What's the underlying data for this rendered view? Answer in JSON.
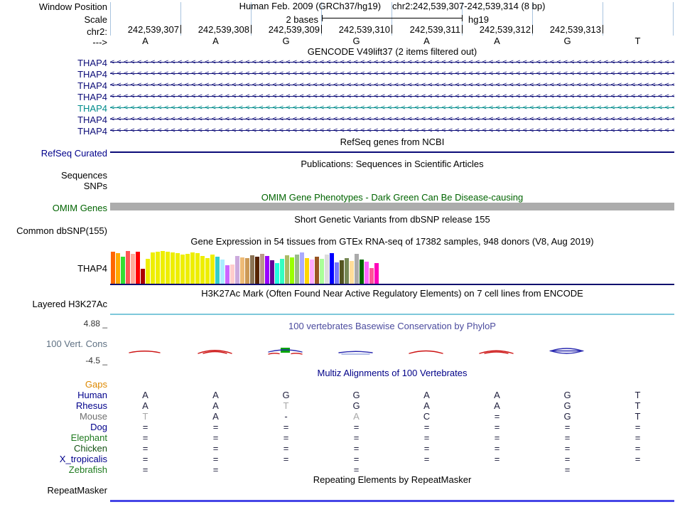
{
  "header": {
    "window_label": "Window Position",
    "assembly_title": "Human Feb. 2009 (GRCh37/hg19)",
    "position_range": "chr2:242,539,307-242,539,314 (8 bp)",
    "scale_label": "Scale",
    "scale_value": "2 bases",
    "scale_genome": "hg19",
    "chrom_label": "chr2:",
    "strand_label": "--->",
    "positions": [
      "242,539,307",
      "242,539,308",
      "242,539,309",
      "242,539,310",
      "242,539,311",
      "242,539,312",
      "242,539,313"
    ],
    "bases": [
      "A",
      "A",
      "G",
      "G",
      "A",
      "A",
      "G",
      "T"
    ]
  },
  "tracks": {
    "gencode": {
      "title": "GENCODE V49lift37 (2 items filtered out)",
      "arrow": "<",
      "rows": [
        {
          "label": "THAP4",
          "color": "#0C0C78"
        },
        {
          "label": "THAP4",
          "color": "#0C0C78"
        },
        {
          "label": "THAP4",
          "color": "#0C0C78"
        },
        {
          "label": "THAP4",
          "color": "#0C0C78"
        },
        {
          "label": "THAP4",
          "color": "#008B8B"
        },
        {
          "label": "THAP4",
          "color": "#0C0C78"
        },
        {
          "label": "THAP4",
          "color": "#0C0C78"
        }
      ]
    },
    "refseq": {
      "title": "RefSeq genes from NCBI",
      "label": "RefSeq Curated",
      "color": "#0C0C78"
    },
    "publications": {
      "title": "Publications: Sequences in Scientific Articles",
      "rows": [
        "Sequences",
        "SNPs"
      ]
    },
    "omim": {
      "title": "OMIM Gene Phenotypes - Dark Green Can Be Disease-causing",
      "label": "OMIM Genes",
      "color": "#006400",
      "bar_color": "#ACACAC"
    },
    "dbsnp": {
      "title": "Short Genetic Variants from dbSNP release 155",
      "label": "Common dbSNP(155)"
    },
    "gtex": {
      "title": "Gene Expression in 54 tissues from GTEx RNA-seq of 17382 samples, 948 donors (V8, Aug 2019)",
      "label": "THAP4"
    },
    "h3k27ac": {
      "title": "H3K27Ac Mark (Often Found Near Active Regulatory Elements) on 7 cell lines from ENCODE",
      "label": "Layered H3K27Ac",
      "color": "#7EC8DB"
    },
    "phylop": {
      "title": "100 vertebrates Basewise Conservation by PhyloP",
      "label": "100 Vert. Cons",
      "max": "4.88 _",
      "min": "-4.5 _",
      "title_color": "#4B4B9E",
      "label_color": "#5F7183"
    },
    "multiz": {
      "title": "Multiz Alignments of 100 Vertebrates",
      "title_color": "#000088",
      "rows": [
        {
          "label": "Gaps",
          "color": "#DD8800",
          "cells": [
            {},
            {},
            {},
            {},
            {},
            {},
            {},
            {}
          ]
        },
        {
          "label": "Human",
          "color": "#00008B",
          "cells": [
            {
              "t": "A"
            },
            {
              "t": "A"
            },
            {
              "t": "G"
            },
            {
              "t": "G"
            },
            {
              "t": "A"
            },
            {
              "t": "A"
            },
            {
              "t": "G"
            },
            {
              "t": "T"
            }
          ]
        },
        {
          "label": "Rhesus",
          "color": "#00008B",
          "cells": [
            {
              "t": "A"
            },
            {
              "t": "A"
            },
            {
              "t": "T",
              "gray": true
            },
            {
              "t": "G"
            },
            {
              "t": "A"
            },
            {
              "t": "A"
            },
            {
              "t": "G"
            },
            {
              "t": "T"
            }
          ]
        },
        {
          "label": "Mouse",
          "color": "#6E6E6E",
          "cells": [
            {
              "t": "T",
              "gray": true
            },
            {
              "t": "A"
            },
            {
              "t": "-"
            },
            {
              "t": "A",
              "gray": true
            },
            {
              "t": "C"
            },
            {
              "t": "="
            },
            {
              "t": "G"
            },
            {
              "t": "T"
            }
          ]
        },
        {
          "label": "Dog",
          "color": "#00008B",
          "cells": [
            {
              "t": "="
            },
            {
              "t": "="
            },
            {
              "t": "="
            },
            {
              "t": "="
            },
            {
              "t": "="
            },
            {
              "t": "="
            },
            {
              "t": "="
            },
            {
              "t": "="
            }
          ]
        },
        {
          "label": "Elephant",
          "color": "#1F7A1F",
          "cells": [
            {
              "t": "="
            },
            {
              "t": "="
            },
            {
              "t": "="
            },
            {
              "t": "="
            },
            {
              "t": "="
            },
            {
              "t": "="
            },
            {
              "t": "="
            },
            {
              "t": "="
            }
          ]
        },
        {
          "label": "Chicken",
          "color": "#145214",
          "cells": [
            {
              "t": "="
            },
            {
              "t": "="
            },
            {
              "t": "="
            },
            {
              "t": "="
            },
            {
              "t": "="
            },
            {
              "t": "="
            },
            {
              "t": "="
            },
            {
              "t": "="
            }
          ]
        },
        {
          "label": "X_tropicalis",
          "color": "#00008B",
          "cells": [
            {
              "t": "="
            },
            {
              "t": "="
            },
            {
              "t": "="
            },
            {
              "t": "="
            },
            {
              "t": "="
            },
            {
              "t": "="
            },
            {
              "t": "="
            },
            {
              "t": "="
            }
          ]
        },
        {
          "label": "Zebrafish",
          "color": "#1F7A1F",
          "cells": [
            {
              "t": "="
            },
            {
              "t": "="
            },
            {},
            {
              "t": "="
            },
            {},
            {},
            {
              "t": "="
            },
            {}
          ]
        }
      ]
    },
    "repeatmasker": {
      "title": "Repeating Elements by RepeatMasker",
      "label": "RepeatMasker"
    }
  },
  "chart_data": {
    "type": "bar",
    "title": "Gene Expression in 54 tissues from GTEx RNA-seq of 17382 samples, 948 donors (V8, Aug 2019)",
    "gene": "THAP4",
    "note": "54 GTEx tissue bars; tissue names not visible in image; values are bar heights (px) estimated from screenshot",
    "values": [
      45,
      43,
      38,
      46,
      42,
      45,
      21,
      35,
      44,
      45,
      46,
      45,
      44,
      43,
      41,
      42,
      44,
      43,
      39,
      36,
      41,
      38,
      34,
      26,
      27,
      39,
      37,
      36,
      40,
      38,
      42,
      39,
      33,
      29,
      35,
      40,
      37,
      41,
      44,
      36,
      34,
      38,
      35,
      41,
      43,
      30,
      33,
      36,
      32,
      42,
      34,
      31,
      22,
      29
    ],
    "colors": [
      "#FF6600",
      "#FFAA00",
      "#33DD33",
      "#FF5555",
      "#FFAA99",
      "#FF0000",
      "#AA0000",
      "#EEEE00",
      "#EEEE00",
      "#EEEE00",
      "#EEEE00",
      "#EEEE00",
      "#EEEE00",
      "#EEEE00",
      "#EEEE00",
      "#EEEE00",
      "#EEEE00",
      "#EEEE00",
      "#EEEE00",
      "#EEEE00",
      "#EEEE00",
      "#33CCCC",
      "#AAEEFF",
      "#CC66FF",
      "#FFCCCC",
      "#CCAADD",
      "#EEBB77",
      "#CC9955",
      "#8B7355",
      "#552200",
      "#BB9988",
      "#9900FF",
      "#660099",
      "#22FFDD",
      "#33FFC2",
      "#AABB66",
      "#99FF00",
      "#99BB88",
      "#AAAAFF",
      "#FFD700",
      "#FFAAFF",
      "#995522",
      "#AAFF99",
      "#DDDDDD",
      "#0000FF",
      "#7777FF",
      "#555522",
      "#778855",
      "#FFDD99",
      "#AAAAAA",
      "#006600",
      "#FF66FF",
      "#FF5599",
      "#FF00BB"
    ],
    "baseline_color": "#10106E"
  }
}
